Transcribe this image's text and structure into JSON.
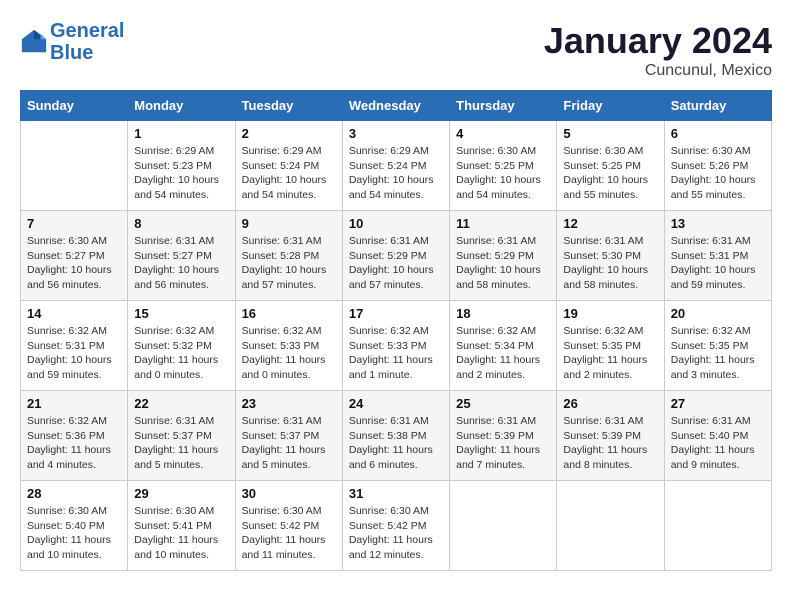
{
  "header": {
    "logo_line1": "General",
    "logo_line2": "Blue",
    "month_year": "January 2024",
    "location": "Cuncunul, Mexico"
  },
  "days_of_week": [
    "Sunday",
    "Monday",
    "Tuesday",
    "Wednesday",
    "Thursday",
    "Friday",
    "Saturday"
  ],
  "weeks": [
    [
      {
        "num": "",
        "sunrise": "",
        "sunset": "",
        "daylight": "",
        "empty": true
      },
      {
        "num": "1",
        "sunrise": "Sunrise: 6:29 AM",
        "sunset": "Sunset: 5:23 PM",
        "daylight": "Daylight: 10 hours and 54 minutes."
      },
      {
        "num": "2",
        "sunrise": "Sunrise: 6:29 AM",
        "sunset": "Sunset: 5:24 PM",
        "daylight": "Daylight: 10 hours and 54 minutes."
      },
      {
        "num": "3",
        "sunrise": "Sunrise: 6:29 AM",
        "sunset": "Sunset: 5:24 PM",
        "daylight": "Daylight: 10 hours and 54 minutes."
      },
      {
        "num": "4",
        "sunrise": "Sunrise: 6:30 AM",
        "sunset": "Sunset: 5:25 PM",
        "daylight": "Daylight: 10 hours and 54 minutes."
      },
      {
        "num": "5",
        "sunrise": "Sunrise: 6:30 AM",
        "sunset": "Sunset: 5:25 PM",
        "daylight": "Daylight: 10 hours and 55 minutes."
      },
      {
        "num": "6",
        "sunrise": "Sunrise: 6:30 AM",
        "sunset": "Sunset: 5:26 PM",
        "daylight": "Daylight: 10 hours and 55 minutes."
      }
    ],
    [
      {
        "num": "7",
        "sunrise": "Sunrise: 6:30 AM",
        "sunset": "Sunset: 5:27 PM",
        "daylight": "Daylight: 10 hours and 56 minutes."
      },
      {
        "num": "8",
        "sunrise": "Sunrise: 6:31 AM",
        "sunset": "Sunset: 5:27 PM",
        "daylight": "Daylight: 10 hours and 56 minutes."
      },
      {
        "num": "9",
        "sunrise": "Sunrise: 6:31 AM",
        "sunset": "Sunset: 5:28 PM",
        "daylight": "Daylight: 10 hours and 57 minutes."
      },
      {
        "num": "10",
        "sunrise": "Sunrise: 6:31 AM",
        "sunset": "Sunset: 5:29 PM",
        "daylight": "Daylight: 10 hours and 57 minutes."
      },
      {
        "num": "11",
        "sunrise": "Sunrise: 6:31 AM",
        "sunset": "Sunset: 5:29 PM",
        "daylight": "Daylight: 10 hours and 58 minutes."
      },
      {
        "num": "12",
        "sunrise": "Sunrise: 6:31 AM",
        "sunset": "Sunset: 5:30 PM",
        "daylight": "Daylight: 10 hours and 58 minutes."
      },
      {
        "num": "13",
        "sunrise": "Sunrise: 6:31 AM",
        "sunset": "Sunset: 5:31 PM",
        "daylight": "Daylight: 10 hours and 59 minutes."
      }
    ],
    [
      {
        "num": "14",
        "sunrise": "Sunrise: 6:32 AM",
        "sunset": "Sunset: 5:31 PM",
        "daylight": "Daylight: 10 hours and 59 minutes."
      },
      {
        "num": "15",
        "sunrise": "Sunrise: 6:32 AM",
        "sunset": "Sunset: 5:32 PM",
        "daylight": "Daylight: 11 hours and 0 minutes."
      },
      {
        "num": "16",
        "sunrise": "Sunrise: 6:32 AM",
        "sunset": "Sunset: 5:33 PM",
        "daylight": "Daylight: 11 hours and 0 minutes."
      },
      {
        "num": "17",
        "sunrise": "Sunrise: 6:32 AM",
        "sunset": "Sunset: 5:33 PM",
        "daylight": "Daylight: 11 hours and 1 minute."
      },
      {
        "num": "18",
        "sunrise": "Sunrise: 6:32 AM",
        "sunset": "Sunset: 5:34 PM",
        "daylight": "Daylight: 11 hours and 2 minutes."
      },
      {
        "num": "19",
        "sunrise": "Sunrise: 6:32 AM",
        "sunset": "Sunset: 5:35 PM",
        "daylight": "Daylight: 11 hours and 2 minutes."
      },
      {
        "num": "20",
        "sunrise": "Sunrise: 6:32 AM",
        "sunset": "Sunset: 5:35 PM",
        "daylight": "Daylight: 11 hours and 3 minutes."
      }
    ],
    [
      {
        "num": "21",
        "sunrise": "Sunrise: 6:32 AM",
        "sunset": "Sunset: 5:36 PM",
        "daylight": "Daylight: 11 hours and 4 minutes."
      },
      {
        "num": "22",
        "sunrise": "Sunrise: 6:31 AM",
        "sunset": "Sunset: 5:37 PM",
        "daylight": "Daylight: 11 hours and 5 minutes."
      },
      {
        "num": "23",
        "sunrise": "Sunrise: 6:31 AM",
        "sunset": "Sunset: 5:37 PM",
        "daylight": "Daylight: 11 hours and 5 minutes."
      },
      {
        "num": "24",
        "sunrise": "Sunrise: 6:31 AM",
        "sunset": "Sunset: 5:38 PM",
        "daylight": "Daylight: 11 hours and 6 minutes."
      },
      {
        "num": "25",
        "sunrise": "Sunrise: 6:31 AM",
        "sunset": "Sunset: 5:39 PM",
        "daylight": "Daylight: 11 hours and 7 minutes."
      },
      {
        "num": "26",
        "sunrise": "Sunrise: 6:31 AM",
        "sunset": "Sunset: 5:39 PM",
        "daylight": "Daylight: 11 hours and 8 minutes."
      },
      {
        "num": "27",
        "sunrise": "Sunrise: 6:31 AM",
        "sunset": "Sunset: 5:40 PM",
        "daylight": "Daylight: 11 hours and 9 minutes."
      }
    ],
    [
      {
        "num": "28",
        "sunrise": "Sunrise: 6:30 AM",
        "sunset": "Sunset: 5:40 PM",
        "daylight": "Daylight: 11 hours and 10 minutes."
      },
      {
        "num": "29",
        "sunrise": "Sunrise: 6:30 AM",
        "sunset": "Sunset: 5:41 PM",
        "daylight": "Daylight: 11 hours and 10 minutes."
      },
      {
        "num": "30",
        "sunrise": "Sunrise: 6:30 AM",
        "sunset": "Sunset: 5:42 PM",
        "daylight": "Daylight: 11 hours and 11 minutes."
      },
      {
        "num": "31",
        "sunrise": "Sunrise: 6:30 AM",
        "sunset": "Sunset: 5:42 PM",
        "daylight": "Daylight: 11 hours and 12 minutes."
      },
      {
        "num": "",
        "sunrise": "",
        "sunset": "",
        "daylight": "",
        "empty": true
      },
      {
        "num": "",
        "sunrise": "",
        "sunset": "",
        "daylight": "",
        "empty": true
      },
      {
        "num": "",
        "sunrise": "",
        "sunset": "",
        "daylight": "",
        "empty": true
      }
    ]
  ]
}
